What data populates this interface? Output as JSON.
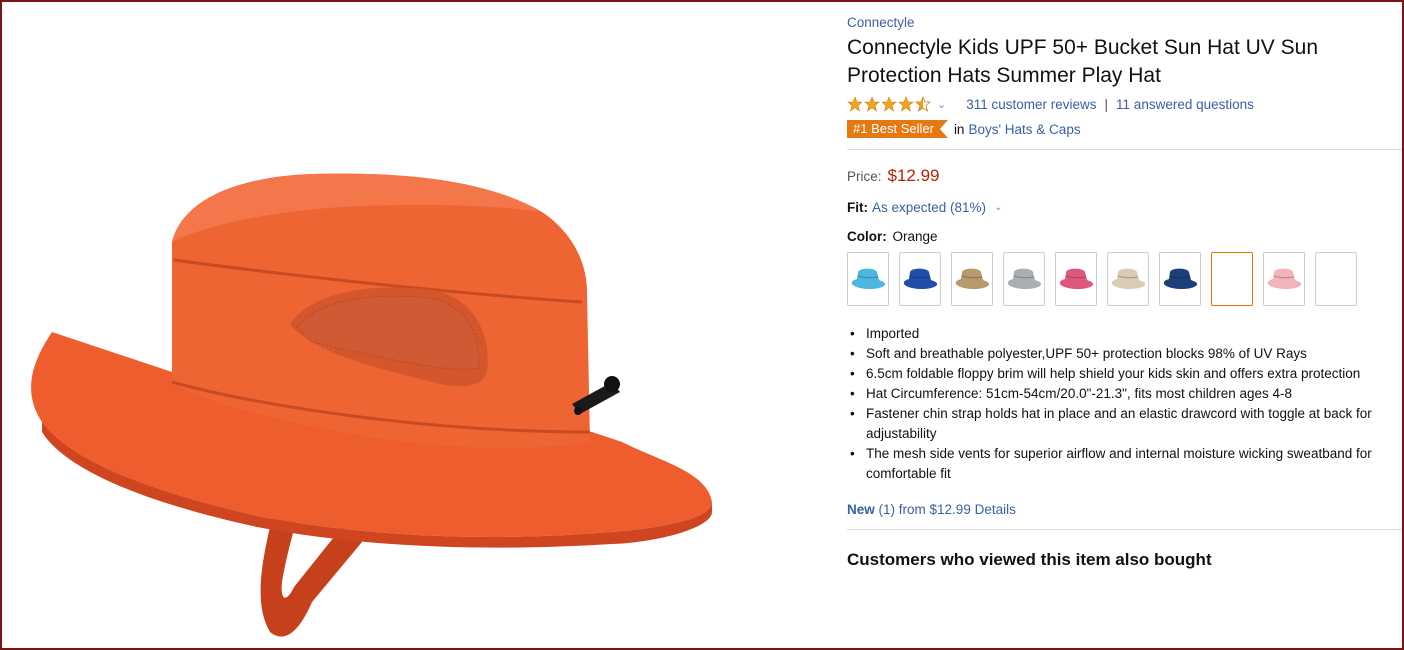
{
  "product": {
    "brand": "Connectyle",
    "title": "Connectyle Kids UPF 50+ Bucket Sun Hat UV Sun Protection Hats Summer Play Hat",
    "rating": 4.5,
    "reviews_link": "311 customer reviews",
    "questions_link": "11 answered questions",
    "separator": "|",
    "best_seller_badge": "#1 Best Seller",
    "in_text": "in",
    "category_link": "Boys' Hats & Caps"
  },
  "price": {
    "label": "Price:",
    "value": "$12.99"
  },
  "fit": {
    "label": "Fit:",
    "value": "As expected (81%)"
  },
  "color": {
    "label": "Color:",
    "value": "Orange",
    "swatches": [
      {
        "name": "light-blue",
        "hex": "#4fb6e0"
      },
      {
        "name": "royal-blue",
        "hex": "#1f4fa8"
      },
      {
        "name": "khaki",
        "hex": "#b89a6c"
      },
      {
        "name": "gray",
        "hex": "#a9aeb5"
      },
      {
        "name": "pink",
        "hex": "#e0577d"
      },
      {
        "name": "beige",
        "hex": "#d8ccb4"
      },
      {
        "name": "navy",
        "hex": "#1d3f7a"
      },
      {
        "name": "orange",
        "hex": "#ffffff",
        "selected": true
      },
      {
        "name": "light-pink",
        "hex": "#f2b4b8"
      },
      {
        "name": "white",
        "hex": "#ffffff"
      }
    ]
  },
  "features": [
    "Imported",
    "Soft and breathable polyester,UPF 50+ protection blocks 98% of UV Rays",
    "6.5cm foldable floppy brim will help shield your kids skin and offers extra protection",
    "Hat Circumference: 51cm-54cm/20.0\"-21.3\", fits most children ages 4-8",
    "Fastener chin strap holds hat in place and an elastic drawcord with toggle at back for adjustability",
    "The mesh side vents for superior airflow and internal moisture wicking sweatband for comfortable fit"
  ],
  "offers": {
    "new_label": "New",
    "rest": "(1) from $12.99",
    "details_link": "Details"
  },
  "also_bought_heading": "Customers who viewed this item also bought",
  "colors": {
    "link": "#3a5fa6",
    "price": "#b12704",
    "badge": "#e47911",
    "star": "#f0a41c",
    "hat": "#ec5b2c",
    "frame_border": "#7b1414"
  }
}
